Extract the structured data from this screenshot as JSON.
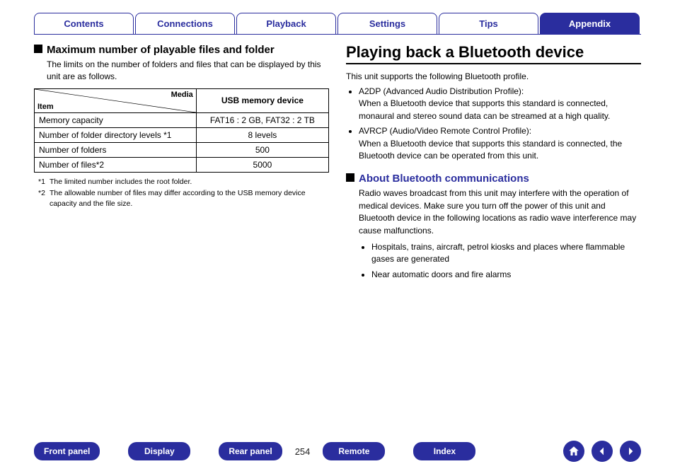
{
  "topTabs": [
    {
      "label": "Contents",
      "active": false
    },
    {
      "label": "Connections",
      "active": false
    },
    {
      "label": "Playback",
      "active": false
    },
    {
      "label": "Settings",
      "active": false
    },
    {
      "label": "Tips",
      "active": false
    },
    {
      "label": "Appendix",
      "active": true
    }
  ],
  "left": {
    "heading": "Maximum number of playable files and folder",
    "intro": "The limits on the number of folders and files that can be displayed by this unit are as follows.",
    "table": {
      "itemLabel": "Item",
      "mediaLabel": "Media",
      "colHeader": "USB memory device",
      "rows": [
        {
          "item": "Memory capacity",
          "value": "FAT16 : 2 GB, FAT32 : 2 TB"
        },
        {
          "item": "Number of folder directory levels *1",
          "value": "8 levels"
        },
        {
          "item": "Number of folders",
          "value": "500"
        },
        {
          "item": "Number of files*2",
          "value": "5000"
        }
      ]
    },
    "footnotes": [
      {
        "num": "*1",
        "text": "The limited number includes the root folder."
      },
      {
        "num": "*2",
        "text": "The allowable number of files may differ according to the USB memory device capacity and the file size."
      }
    ]
  },
  "right": {
    "title": "Playing back a Bluetooth device",
    "intro": "This unit supports the following Bluetooth profile.",
    "profiles": [
      {
        "name": "A2DP (Advanced Audio Distribution Profile):",
        "desc": "When a Bluetooth device that supports this standard is connected, monaural and stereo sound data can be streamed at a high quality."
      },
      {
        "name": "AVRCP (Audio/Video Remote Control Profile):",
        "desc": "When a Bluetooth device that supports this standard is connected, the Bluetooth device can be operated from this unit."
      }
    ],
    "sub": {
      "heading": "About Bluetooth communications",
      "body": "Radio waves broadcast from this unit may interfere with the operation of medical devices. Make sure you turn off the power of this unit and Bluetooth device in the following locations as radio wave interference may cause malfunctions.",
      "bullets": [
        "Hospitals, trains, aircraft, petrol kiosks and places where flammable gases are generated",
        "Near automatic doors and fire alarms"
      ]
    }
  },
  "bottom": {
    "buttons1": [
      "Front panel",
      "Display",
      "Rear panel"
    ],
    "pageNum": "254",
    "buttons2": [
      "Remote",
      "Index"
    ]
  }
}
